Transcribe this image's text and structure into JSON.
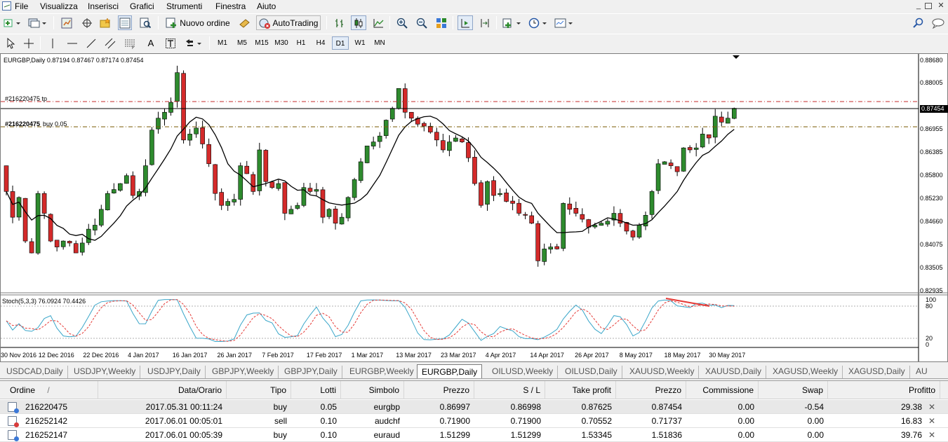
{
  "menu": [
    "File",
    "Visualizza",
    "Inserisci",
    "Grafici",
    "Strumenti",
    "Finestra",
    "Aiuto"
  ],
  "toolbar": {
    "new_order_label": "Nuovo ordine",
    "autotrading_label": "AutoTrading",
    "timeframes": [
      "M1",
      "M5",
      "M15",
      "M30",
      "H1",
      "H4",
      "D1",
      "W1",
      "MN"
    ],
    "active_timeframe": "D1",
    "text_tool_label": "A"
  },
  "chart": {
    "title": "EURGBP,Daily  0.87194 0.87467 0.87174 0.87454",
    "tp_label": "#216220475 tp",
    "buy_label": "#216220475",
    "buy_detail": "buy 0.05",
    "current_price": "0.87454",
    "price_ticks": [
      "0.88680",
      "0.88005",
      "0.86955",
      "0.86385",
      "0.85800",
      "0.85230",
      "0.84660",
      "0.84075",
      "0.83505",
      "0.82935"
    ],
    "oscillator_title": "Stoch(5,3,3) 76.0924 70.4426",
    "oscillator_ticks": [
      "100",
      "80",
      "20",
      "0"
    ],
    "date_ticks": [
      "30 Nov 2016",
      "12 Dec 2016",
      "22 Dec 2016",
      "4 Jan 2017",
      "16 Jan 2017",
      "26 Jan 2017",
      "7 Feb 2017",
      "17 Feb 2017",
      "1 Mar 2017",
      "13 Mar 2017",
      "23 Mar 2017",
      "4 Apr 2017",
      "14 Apr 2017",
      "26 Apr 2017",
      "8 May 2017",
      "18 May 2017",
      "30 May 2017"
    ],
    "colors": {
      "bull": "#2e8b2e",
      "bear": "#d42a2a",
      "ma": "#000000",
      "tp_line": "#c62828",
      "entry_line": "#7a5a00",
      "stoch_main": "#3aa6c9",
      "stoch_signal": "#e53935"
    }
  },
  "chart_data": {
    "type": "candlestick",
    "symbol": "EURGBP",
    "timeframe": "Daily",
    "ohlc_last": {
      "open": 0.87194,
      "high": 0.87467,
      "low": 0.87174,
      "close": 0.87454
    },
    "ylim": [
      0.82935,
      0.8868
    ],
    "closes": [
      0.8535,
      0.847,
      0.852,
      0.841,
      0.838,
      0.853,
      0.848,
      0.841,
      0.8395,
      0.841,
      0.8405,
      0.838,
      0.8405,
      0.844,
      0.845,
      0.849,
      0.853,
      0.854,
      0.8555,
      0.8575,
      0.8525,
      0.8535,
      0.86,
      0.869,
      0.872,
      0.8735,
      0.876,
      0.8835,
      0.8665,
      0.868,
      0.8695,
      0.8655,
      0.8605,
      0.853,
      0.85,
      0.851,
      0.8515,
      0.86,
      0.858,
      0.8535,
      0.864,
      0.856,
      0.8545,
      0.8555,
      0.848,
      0.849,
      0.85,
      0.8545,
      0.8535,
      0.854,
      0.847,
      0.849,
      0.8455,
      0.847,
      0.852,
      0.8565,
      0.861,
      0.865,
      0.866,
      0.8675,
      0.8715,
      0.8745,
      0.8795,
      0.8735,
      0.872,
      0.8705,
      0.87,
      0.8685,
      0.8665,
      0.864,
      0.866,
      0.867,
      0.866,
      0.862,
      0.8555,
      0.85,
      0.856,
      0.8525,
      0.853,
      0.851,
      0.8505,
      0.848,
      0.8475,
      0.8455,
      0.836,
      0.839,
      0.8395,
      0.839,
      0.8505,
      0.849,
      0.848,
      0.8465,
      0.8445,
      0.845,
      0.8455,
      0.846,
      0.848,
      0.8455,
      0.8435,
      0.842,
      0.845,
      0.8475,
      0.8535,
      0.8605,
      0.861,
      0.86,
      0.8585,
      0.8645,
      0.864,
      0.8645,
      0.868,
      0.867,
      0.8725,
      0.871,
      0.872,
      0.8745
    ]
  },
  "tabs": [
    "USDCAD,Daily",
    "USDJPY,Weekly",
    "USDJPY,Daily",
    "GBPJPY,Weekly",
    "GBPJPY,Daily",
    "EURGBP,Weekly",
    "EURGBP,Daily",
    "OILUSD,Weekly",
    "OILUSD,Daily",
    "XAUUSD,Weekly",
    "XAUUSD,Daily",
    "XAGUSD,Weekly",
    "XAGUSD,Daily",
    "AU"
  ],
  "active_tab": "EURGBP,Daily",
  "terminal": {
    "columns": [
      "Ordine",
      "Data/Orario",
      "Tipo",
      "Lotti",
      "Simbolo",
      "Prezzo",
      "S / L",
      "Take profit",
      "Prezzo",
      "Commissione",
      "Swap",
      "Profitto"
    ],
    "sort_indicator": "/",
    "rows": [
      {
        "order": "216220475",
        "time": "2017.05.31 00:11:24",
        "type": "buy",
        "lots": "0.05",
        "symbol": "eurgbp",
        "price": "0.86997",
        "sl": "0.86998",
        "tp": "0.87625",
        "cur_price": "0.87454",
        "commission": "0.00",
        "swap": "-0.54",
        "profit": "29.38"
      },
      {
        "order": "216252142",
        "time": "2017.06.01 00:05:01",
        "type": "sell",
        "lots": "0.10",
        "symbol": "audchf",
        "price": "0.71900",
        "sl": "0.71900",
        "tp": "0.70552",
        "cur_price": "0.71737",
        "commission": "0.00",
        "swap": "0.00",
        "profit": "16.83"
      },
      {
        "order": "216252147",
        "time": "2017.06.01 00:05:39",
        "type": "buy",
        "lots": "0.10",
        "symbol": "euraud",
        "price": "1.51299",
        "sl": "1.51299",
        "tp": "1.53345",
        "cur_price": "1.51836",
        "commission": "0.00",
        "swap": "0.00",
        "profit": "39.76"
      }
    ]
  }
}
